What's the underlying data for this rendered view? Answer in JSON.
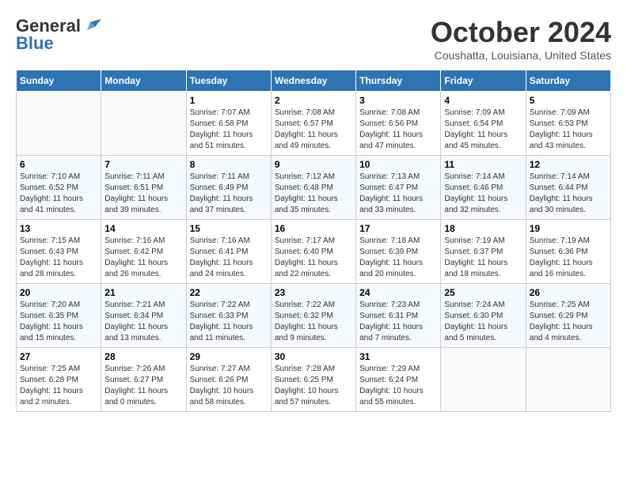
{
  "header": {
    "logo_line1": "General",
    "logo_line2": "Blue",
    "month_title": "October 2024",
    "location": "Coushatta, Louisiana, United States"
  },
  "weekdays": [
    "Sunday",
    "Monday",
    "Tuesday",
    "Wednesday",
    "Thursday",
    "Friday",
    "Saturday"
  ],
  "weeks": [
    [
      {
        "day": "",
        "info": ""
      },
      {
        "day": "",
        "info": ""
      },
      {
        "day": "1",
        "info": "Sunrise: 7:07 AM\nSunset: 6:58 PM\nDaylight: 11 hours and 51 minutes."
      },
      {
        "day": "2",
        "info": "Sunrise: 7:08 AM\nSunset: 6:57 PM\nDaylight: 11 hours and 49 minutes."
      },
      {
        "day": "3",
        "info": "Sunrise: 7:08 AM\nSunset: 6:56 PM\nDaylight: 11 hours and 47 minutes."
      },
      {
        "day": "4",
        "info": "Sunrise: 7:09 AM\nSunset: 6:54 PM\nDaylight: 11 hours and 45 minutes."
      },
      {
        "day": "5",
        "info": "Sunrise: 7:09 AM\nSunset: 6:53 PM\nDaylight: 11 hours and 43 minutes."
      }
    ],
    [
      {
        "day": "6",
        "info": "Sunrise: 7:10 AM\nSunset: 6:52 PM\nDaylight: 11 hours and 41 minutes."
      },
      {
        "day": "7",
        "info": "Sunrise: 7:11 AM\nSunset: 6:51 PM\nDaylight: 11 hours and 39 minutes."
      },
      {
        "day": "8",
        "info": "Sunrise: 7:11 AM\nSunset: 6:49 PM\nDaylight: 11 hours and 37 minutes."
      },
      {
        "day": "9",
        "info": "Sunrise: 7:12 AM\nSunset: 6:48 PM\nDaylight: 11 hours and 35 minutes."
      },
      {
        "day": "10",
        "info": "Sunrise: 7:13 AM\nSunset: 6:47 PM\nDaylight: 11 hours and 33 minutes."
      },
      {
        "day": "11",
        "info": "Sunrise: 7:14 AM\nSunset: 6:46 PM\nDaylight: 11 hours and 32 minutes."
      },
      {
        "day": "12",
        "info": "Sunrise: 7:14 AM\nSunset: 6:44 PM\nDaylight: 11 hours and 30 minutes."
      }
    ],
    [
      {
        "day": "13",
        "info": "Sunrise: 7:15 AM\nSunset: 6:43 PM\nDaylight: 11 hours and 28 minutes."
      },
      {
        "day": "14",
        "info": "Sunrise: 7:16 AM\nSunset: 6:42 PM\nDaylight: 11 hours and 26 minutes."
      },
      {
        "day": "15",
        "info": "Sunrise: 7:16 AM\nSunset: 6:41 PM\nDaylight: 11 hours and 24 minutes."
      },
      {
        "day": "16",
        "info": "Sunrise: 7:17 AM\nSunset: 6:40 PM\nDaylight: 11 hours and 22 minutes."
      },
      {
        "day": "17",
        "info": "Sunrise: 7:18 AM\nSunset: 6:39 PM\nDaylight: 11 hours and 20 minutes."
      },
      {
        "day": "18",
        "info": "Sunrise: 7:19 AM\nSunset: 6:37 PM\nDaylight: 11 hours and 18 minutes."
      },
      {
        "day": "19",
        "info": "Sunrise: 7:19 AM\nSunset: 6:36 PM\nDaylight: 11 hours and 16 minutes."
      }
    ],
    [
      {
        "day": "20",
        "info": "Sunrise: 7:20 AM\nSunset: 6:35 PM\nDaylight: 11 hours and 15 minutes."
      },
      {
        "day": "21",
        "info": "Sunrise: 7:21 AM\nSunset: 6:34 PM\nDaylight: 11 hours and 13 minutes."
      },
      {
        "day": "22",
        "info": "Sunrise: 7:22 AM\nSunset: 6:33 PM\nDaylight: 11 hours and 11 minutes."
      },
      {
        "day": "23",
        "info": "Sunrise: 7:22 AM\nSunset: 6:32 PM\nDaylight: 11 hours and 9 minutes."
      },
      {
        "day": "24",
        "info": "Sunrise: 7:23 AM\nSunset: 6:31 PM\nDaylight: 11 hours and 7 minutes."
      },
      {
        "day": "25",
        "info": "Sunrise: 7:24 AM\nSunset: 6:30 PM\nDaylight: 11 hours and 5 minutes."
      },
      {
        "day": "26",
        "info": "Sunrise: 7:25 AM\nSunset: 6:29 PM\nDaylight: 11 hours and 4 minutes."
      }
    ],
    [
      {
        "day": "27",
        "info": "Sunrise: 7:25 AM\nSunset: 6:28 PM\nDaylight: 11 hours and 2 minutes."
      },
      {
        "day": "28",
        "info": "Sunrise: 7:26 AM\nSunset: 6:27 PM\nDaylight: 11 hours and 0 minutes."
      },
      {
        "day": "29",
        "info": "Sunrise: 7:27 AM\nSunset: 6:26 PM\nDaylight: 10 hours and 58 minutes."
      },
      {
        "day": "30",
        "info": "Sunrise: 7:28 AM\nSunset: 6:25 PM\nDaylight: 10 hours and 57 minutes."
      },
      {
        "day": "31",
        "info": "Sunrise: 7:29 AM\nSunset: 6:24 PM\nDaylight: 10 hours and 55 minutes."
      },
      {
        "day": "",
        "info": ""
      },
      {
        "day": "",
        "info": ""
      }
    ]
  ]
}
